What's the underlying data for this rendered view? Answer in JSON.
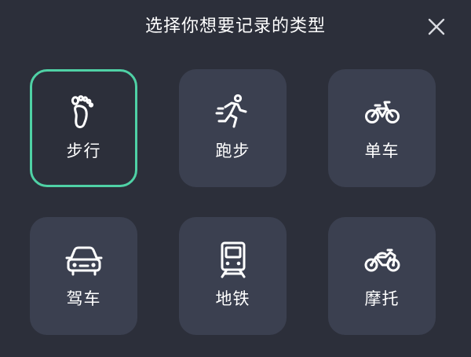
{
  "dialog": {
    "title": "选择你想要记录的类型",
    "close_icon": "close-icon"
  },
  "accent_color": "#4fd1a5",
  "types": [
    {
      "label": "步行",
      "icon": "footprint-icon",
      "selected": true
    },
    {
      "label": "跑步",
      "icon": "runner-icon",
      "selected": false
    },
    {
      "label": "单车",
      "icon": "bicycle-icon",
      "selected": false
    },
    {
      "label": "驾车",
      "icon": "car-icon",
      "selected": false
    },
    {
      "label": "地铁",
      "icon": "subway-icon",
      "selected": false
    },
    {
      "label": "摩托",
      "icon": "motorcycle-icon",
      "selected": false
    }
  ]
}
